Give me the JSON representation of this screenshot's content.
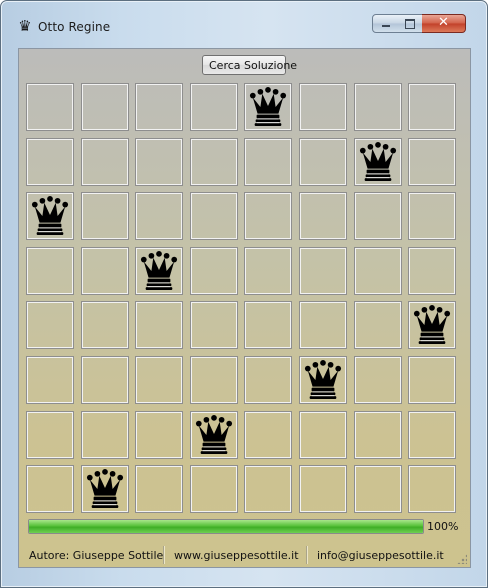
{
  "window": {
    "title": "Otto Regine",
    "icon": "queen-icon"
  },
  "toolbar": {
    "solve_label": "Cerca Soluzione"
  },
  "board": {
    "size": 8,
    "queens": [
      {
        "row": 0,
        "col": 4
      },
      {
        "row": 1,
        "col": 6
      },
      {
        "row": 2,
        "col": 0
      },
      {
        "row": 3,
        "col": 2
      },
      {
        "row": 4,
        "col": 7
      },
      {
        "row": 5,
        "col": 5
      },
      {
        "row": 6,
        "col": 3
      },
      {
        "row": 7,
        "col": 1
      }
    ]
  },
  "progress": {
    "value": 1.0,
    "label": "100%"
  },
  "status": {
    "author": "Autore: Giuseppe Sottile",
    "website": "www.giuseppesottile.it",
    "email": "info@giuseppesottile.it"
  },
  "colors": {
    "progress_green": "#4cbb30",
    "close_red": "#c9462e"
  }
}
